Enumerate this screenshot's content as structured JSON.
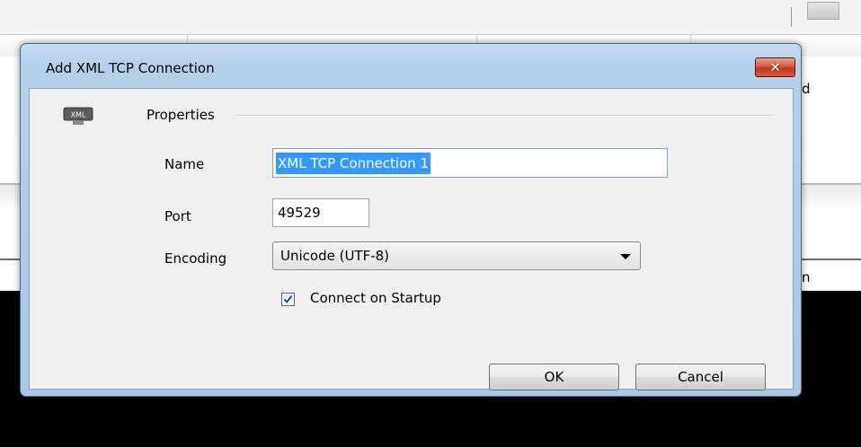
{
  "background_app": {
    "row_fragment_right": "d",
    "lower_header_fragment_right": "n"
  },
  "dialog": {
    "title": "Add XML TCP Connection",
    "close_glyph": "✕",
    "icon": "xml-icon",
    "section_label": "Properties",
    "fields": {
      "name_label": "Name",
      "name_value": "XML TCP Connection 1",
      "port_label": "Port",
      "port_value": "49529",
      "encoding_label": "Encoding",
      "encoding_value": "Unicode (UTF-8)"
    },
    "connect_on_startup": {
      "label": "Connect on Startup",
      "checked": true
    },
    "ok_label": "OK",
    "cancel_label": "Cancel"
  },
  "colors": {
    "title_bar": "#b7d0ea",
    "selection": "#3399ff",
    "close_button": "#c2391b",
    "client_bg": "#f0f0f0"
  }
}
